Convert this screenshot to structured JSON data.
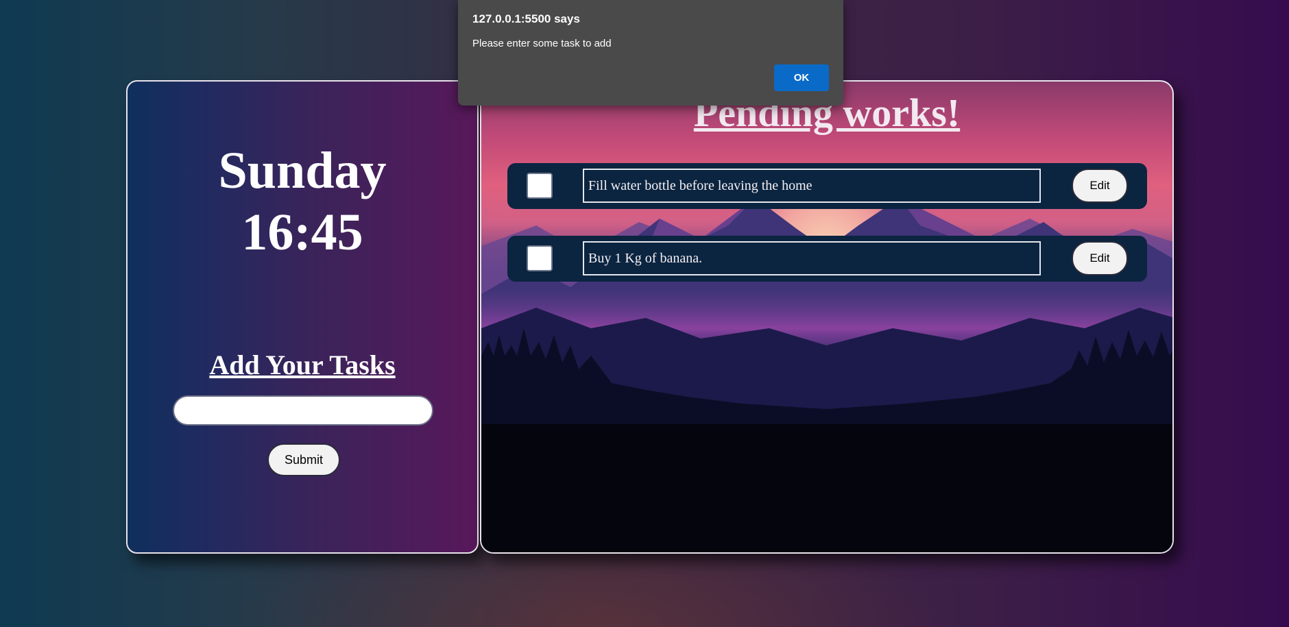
{
  "clock": {
    "day": "Sunday",
    "time": "16:45"
  },
  "add_panel": {
    "heading": "Add Your Tasks",
    "input_value": "",
    "submit_label": "Submit"
  },
  "pending_panel": {
    "title": "Pending works!",
    "tasks": [
      {
        "text": "Fill water bottle before leaving the home",
        "checked": false,
        "edit_label": "Edit"
      },
      {
        "text": "Buy 1 Kg of banana.",
        "checked": false,
        "edit_label": "Edit"
      }
    ]
  },
  "alert": {
    "title": "127.0.0.1:5500 says",
    "message": "Please enter some task to add",
    "ok_label": "OK"
  },
  "colors": {
    "alert_ok": "#0a6ac8",
    "task_row_bg": "#0b2440",
    "panel_border": "#e9e4ec"
  }
}
